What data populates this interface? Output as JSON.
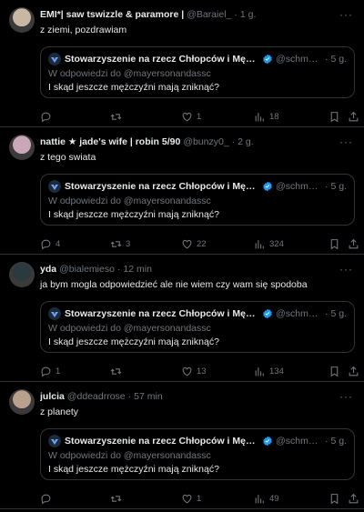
{
  "tweets": [
    {
      "name": "EMI*| saw tswizzle & paramore |",
      "handle": "@Baraiel_",
      "dot": "·",
      "time": "1 g.",
      "text": "z ziemi, pozdrawiam",
      "avatar": "#c9b7a4",
      "quote": {
        "name": "Stowarzyszenie na rzecz Chłopców i Mężcz...",
        "handle": "@schmor...",
        "dot": "·",
        "time": "5 g.",
        "reply": "W odpowiedzi do @mayersonandassc",
        "text": "I skąd jeszcze mężczyźni mają zniknąć?"
      },
      "replies": "",
      "retweets": "",
      "likes": "1",
      "views": "18"
    },
    {
      "name": "nattie ★ jade's wife | robin 5/90",
      "handle": "@bunzy0_",
      "dot": "·",
      "time": "2 g.",
      "text": "z tego swiata",
      "avatar": "#c9a6b8",
      "quote": {
        "name": "Stowarzyszenie na rzecz Chłopców i Mężcz...",
        "handle": "@schmor...",
        "dot": "·",
        "time": "5 g.",
        "reply": "W odpowiedzi do @mayersonandassc",
        "text": "I skąd jeszcze mężczyźni mają zniknąć?"
      },
      "replies": "4",
      "retweets": "3",
      "likes": "22",
      "views": "324"
    },
    {
      "name": "yda",
      "handle": "@bialemieso",
      "dot": "·",
      "time": "12 min",
      "text": "ja bym mogla odpowiedzieć ale nie wiem czy wam się spodoba",
      "avatar": "#2b3a3e",
      "quote": {
        "name": "Stowarzyszenie na rzecz Chłopców i Mężcz...",
        "handle": "@schmor...",
        "dot": "·",
        "time": "5 g.",
        "reply": "W odpowiedzi do @mayersonandassc",
        "text": "I skąd jeszcze mężczyźni mają zniknąć?"
      },
      "replies": "1",
      "retweets": "",
      "likes": "13",
      "views": "134"
    },
    {
      "name": "julcia",
      "handle": "@ddeadrrose",
      "dot": "·",
      "time": "57 min",
      "text": "z planety",
      "avatar": "#b9a08c",
      "quote": {
        "name": "Stowarzyszenie na rzecz Chłopców i Mężcz...",
        "handle": "@schmor...",
        "dot": "·",
        "time": "5 g.",
        "reply": "W odpowiedzi do @mayersonandassc",
        "text": "I skąd jeszcze mężczyźni mają zniknąć?"
      },
      "replies": "",
      "retweets": "",
      "likes": "1",
      "views": "49"
    }
  ],
  "more_glyph": "···",
  "colors": {
    "bg": "#000000",
    "text": "#e7e9ea",
    "muted": "#71767b",
    "border": "#2f3336",
    "verified": "#1d9bf0"
  }
}
